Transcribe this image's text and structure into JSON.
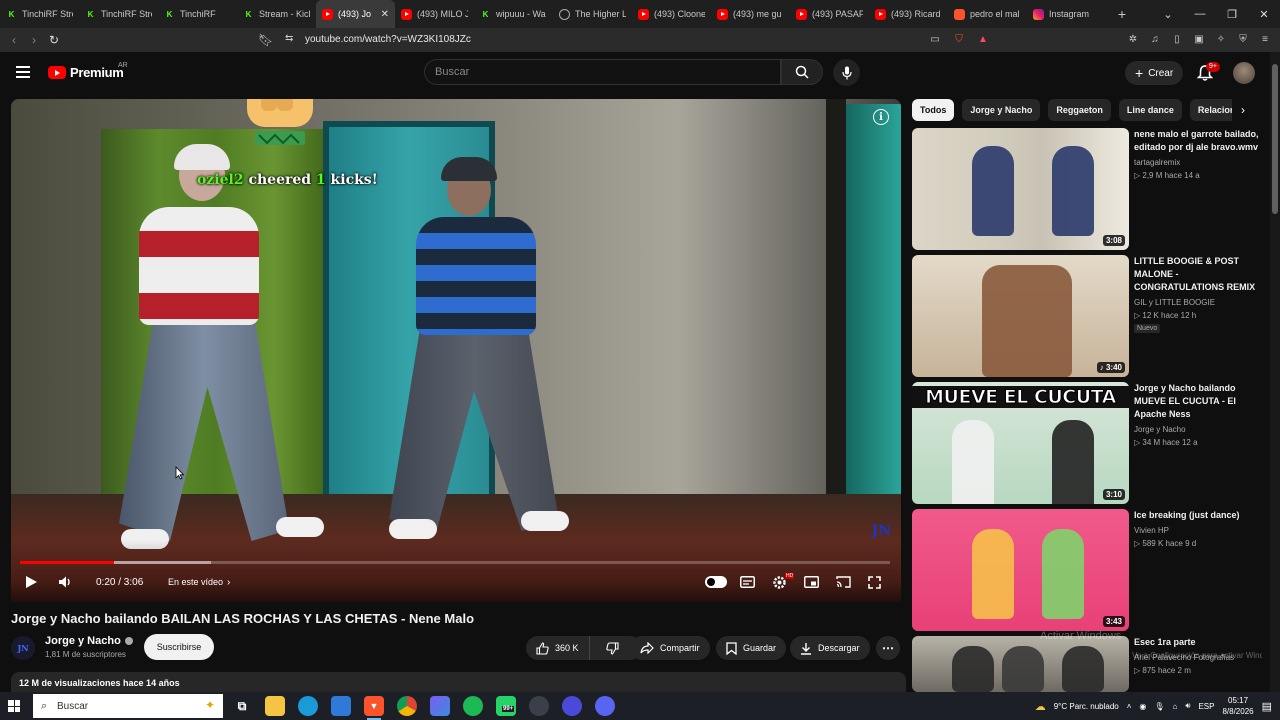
{
  "browser": {
    "tabs": [
      {
        "label": "TinchiRF Stre",
        "icon": "kick"
      },
      {
        "label": "TinchiRF Stre",
        "icon": "kick"
      },
      {
        "label": "TinchiRF",
        "icon": "kick"
      },
      {
        "label": "Stream - Kick",
        "icon": "kick"
      },
      {
        "label": "(493) Jo",
        "icon": "youtube",
        "active": true
      },
      {
        "label": "(493) MILO J",
        "icon": "youtube"
      },
      {
        "label": "wipuuu - Wa",
        "icon": "kick"
      },
      {
        "label": "The Higher L",
        "icon": "generic"
      },
      {
        "label": "(493) Cloone",
        "icon": "youtube"
      },
      {
        "label": "(493) me gu",
        "icon": "youtube"
      },
      {
        "label": "(493) PASAP",
        "icon": "youtube"
      },
      {
        "label": "(493) Ricard",
        "icon": "youtube"
      },
      {
        "label": "pedro el mal",
        "icon": "brave"
      },
      {
        "label": "Instagram",
        "icon": "instagram"
      }
    ],
    "new_tab_label": "+",
    "url": "youtube.com/watch?v=WZ3KI108JZc"
  },
  "youtube": {
    "logo_text": "Premium",
    "country_code": "AR",
    "search_placeholder": "Buscar",
    "create_label": "Crear",
    "notifications_badge": "9+"
  },
  "player": {
    "overlay_user": "oziel2",
    "overlay_cheered": "cheered",
    "overlay_count": "1",
    "overlay_kicks": "kicks!",
    "time": "0:20 / 3:06",
    "progress_fraction": 0.108,
    "buffer_fraction": 0.22,
    "in_this_video": "En este vídeo",
    "hd_badge": "HD"
  },
  "video": {
    "title": "Jorge y Nacho bailando BAILAN LAS ROCHAS Y LAS CHETAS - Nene Malo",
    "channel": "Jorge y Nacho",
    "channel_avatar_text": "JN",
    "subscribers": "1,81 M de suscriptores",
    "subscribe_label": "Suscribirse",
    "likes": "360 K",
    "share_label": "Compartir",
    "save_label": "Guardar",
    "download_label": "Descargar",
    "views_date": "12 M de visualizaciones  hace 14 años"
  },
  "chips": [
    "Todos",
    "Jorge y Nacho",
    "Reggaeton",
    "Line dance",
    "Relaciona"
  ],
  "recommendations": [
    {
      "title": "nene malo el garrote bailado, editado por dj ale bravo.wmv",
      "channel": "tartagalremix",
      "stats": "▷ 2,9 M   hace 14 a",
      "duration": "3:08"
    },
    {
      "title": "LITTLE BOOGIE & POST MALONE - CONGRATULATIONS REMIX",
      "channel": "GIL y LITTLE BOOGIE",
      "stats": "▷ 12 K   hace 12 h",
      "badge": "Nuevo",
      "duration": "♪ 3:40"
    },
    {
      "title": "Jorge y Nacho bailando MUEVE EL CUCUTA - El Apache Ness",
      "channel": "Jorge y Nacho",
      "stats": "▷ 34 M   hace 12 a",
      "duration": "3:10",
      "thumb_text": "MUEVE EL CUCUTA"
    },
    {
      "title": "Ice breaking (just dance)",
      "channel": "Vivien HP",
      "stats": "▷ 589 K   hace 9 d",
      "duration": "3:43"
    },
    {
      "title": "Esec 1ra parte",
      "channel": "Ariel Palavecino Fotografías",
      "stats": "▷ 875   hace 2 m",
      "duration": ""
    }
  ],
  "windows_watermark": {
    "line1": "Activar Windows",
    "line2": "Ve a Configuración para activar Windows."
  },
  "taskbar": {
    "search_label": "Buscar",
    "weather": "9°C  Parc. nublado",
    "language": "ESP",
    "time": "05:17",
    "date": "8/8/2026",
    "spotify_badge": "99+"
  }
}
